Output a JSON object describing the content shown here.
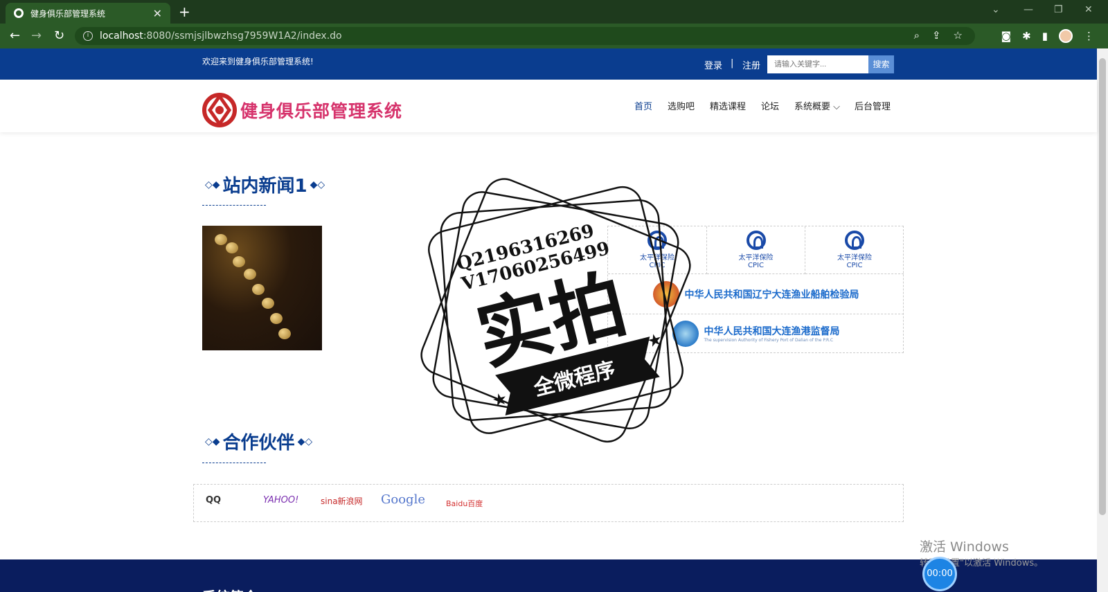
{
  "browser": {
    "tab_title": "健身俱乐部管理系统",
    "url_host": "localhost",
    "url_path": ":8080/ssmjsjlbwzhsg7959W1A2/index.do"
  },
  "topbar": {
    "welcome": "欢迎来到健身俱乐部管理系统!",
    "login": "登录",
    "separator": "|",
    "register": "注册",
    "search_placeholder": "请输入关键字...",
    "search_button": "搜索"
  },
  "header": {
    "site_name": "健身俱乐部管理系统",
    "nav": [
      {
        "label": "首页"
      },
      {
        "label": "选购吧"
      },
      {
        "label": "精选课程"
      },
      {
        "label": "论坛"
      },
      {
        "label": "系统概要 ⌵"
      },
      {
        "label": "后台管理"
      }
    ]
  },
  "sections": {
    "news_title": "站内新闻1",
    "partners_title": "合作伙伴"
  },
  "partners": {
    "cpic_cn": "太平洋保险",
    "cpic_en": "CPIC",
    "org1": "中华人民共和国辽宁大连渔业船舶检验局",
    "org2": "中华人民共和国大连渔港监督局",
    "org2_en": "The supervision Authority of Fishery Port of Dalian of the P.R.C"
  },
  "links": [
    "QQ",
    "YAHOO!",
    "sina新浪网",
    "Google",
    "Baidu百度"
  ],
  "footer": {
    "title": "系统简介"
  },
  "overlay": {
    "watermark_line1": "Q2196316269",
    "watermark_line2": "V17060256499",
    "watermark_big": "实拍",
    "watermark_banner": "全微程序",
    "win_activate": "激活 Windows",
    "win_activate_sub": "转到\"设置\"以激活 Windows。",
    "timer": "00:00"
  },
  "colors": {
    "primary": "#0a3d8f",
    "brand": "#d6336c",
    "footer": "#0a1d5e",
    "chrome": "#2b5a27"
  }
}
